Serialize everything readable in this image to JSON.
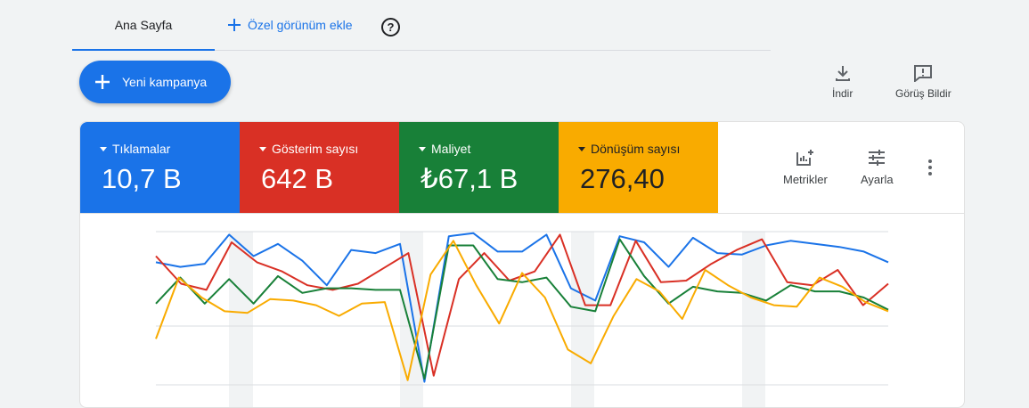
{
  "tabs": {
    "home": "Ana Sayfa",
    "add_view": "Özel görünüm ekle"
  },
  "toolbar": {
    "new_campaign": "Yeni kampanya",
    "download": "İndir",
    "feedback": "Görüş Bildir"
  },
  "metrics": [
    {
      "name": "Tıklamalar",
      "value": "10,7 B",
      "color": "#1a73e8"
    },
    {
      "name": "Gösterim sayısı",
      "value": "642 B",
      "color": "#d93025"
    },
    {
      "name": "Maliyet",
      "value": "₺67,1 B",
      "color": "#188038"
    },
    {
      "name": "Dönüşüm sayısı",
      "value": "276,40",
      "color": "#f9ab00"
    }
  ],
  "card_tools": {
    "metrics": "Metrikler",
    "adjust": "Ayarla"
  },
  "chart_data": {
    "type": "line",
    "x": [
      1,
      2,
      3,
      4,
      5,
      6,
      7,
      8,
      9,
      10,
      11,
      12,
      13,
      14,
      15,
      16,
      17,
      18,
      19,
      20,
      21,
      22,
      23,
      24,
      25,
      26,
      27,
      28,
      29,
      30,
      31,
      32,
      33,
      34,
      35,
      36,
      37
    ],
    "ylim": [
      0,
      100
    ],
    "series": [
      {
        "color": "#1a73e8",
        "values": [
          80,
          77,
          79,
          98,
          84,
          92,
          81,
          65,
          88,
          86,
          92,
          2,
          97,
          99,
          87,
          87,
          98,
          63,
          55,
          97,
          93,
          77,
          96,
          86,
          85,
          91,
          94,
          92,
          90,
          87,
          80
        ]
      },
      {
        "color": "#d93025",
        "values": [
          84,
          66,
          62,
          93,
          80,
          74,
          65,
          62,
          66,
          76,
          86,
          6,
          69,
          86,
          68,
          74,
          98,
          52,
          52,
          94,
          67,
          68,
          79,
          88,
          95,
          67,
          65,
          75,
          52,
          66
        ]
      },
      {
        "color": "#188038",
        "values": [
          53,
          70,
          53,
          69,
          53,
          71,
          60,
          63,
          63,
          62,
          62,
          4,
          91,
          91,
          69,
          67,
          70,
          51,
          48,
          95,
          71,
          53,
          64,
          61,
          60,
          55,
          65,
          61,
          61,
          57,
          49
        ]
      },
      {
        "color": "#f9ab00",
        "values": [
          30,
          70,
          57,
          48,
          47,
          56,
          55,
          52,
          45,
          53,
          54,
          3,
          72,
          94,
          65,
          40,
          73,
          57,
          23,
          14,
          45,
          69,
          61,
          43,
          75,
          65,
          57,
          52,
          51,
          70,
          64,
          54,
          48
        ]
      }
    ]
  }
}
